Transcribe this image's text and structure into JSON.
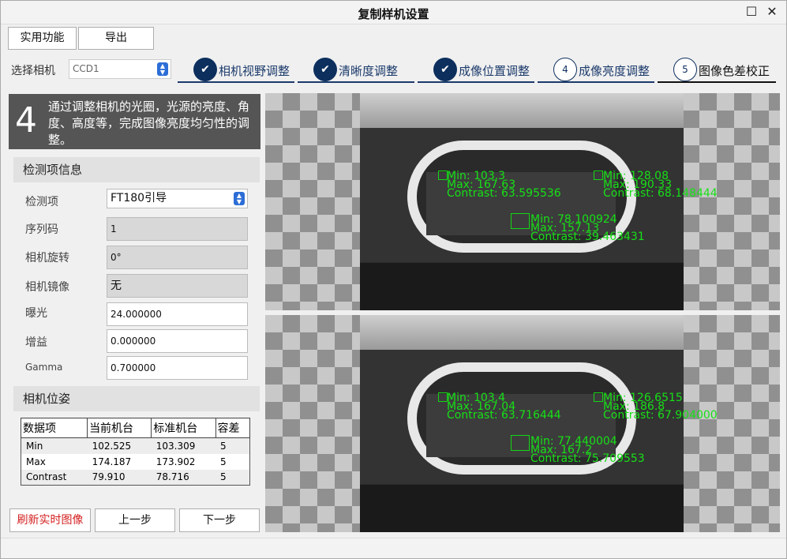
{
  "window": {
    "title": "复制样机设置",
    "maximize_icon": "maximize-icon",
    "close_icon": "close-icon"
  },
  "menu": {
    "utility": "实用功能",
    "export": "导出"
  },
  "camera": {
    "label": "选择相机",
    "selected": "CCD1"
  },
  "steps": [
    {
      "num": "",
      "label": "相机视野调整",
      "state": "done"
    },
    {
      "num": "",
      "label": "清晰度调整",
      "state": "done"
    },
    {
      "num": "",
      "label": "成像位置调整",
      "state": "done"
    },
    {
      "num": "4",
      "label": "成像亮度调整",
      "state": "todo"
    },
    {
      "num": "5",
      "label": "图像色差校正",
      "state": "todo"
    }
  ],
  "banner": {
    "number": "4",
    "text": "通过调整相机的光圈，光源的亮度、角度、高度等，完成图像亮度均匀性的调整。"
  },
  "inspection": {
    "header": "检测项信息",
    "item_label": "检测项",
    "item_value": "FT180引导",
    "serial_label": "序列码",
    "serial_value": "1",
    "rotation_label": "相机旋转",
    "rotation_value": "0°",
    "mirror_label": "相机镜像",
    "mirror_value": "无",
    "exposure_label": "曝光",
    "exposure_value": "24.000000",
    "gain_label": "增益",
    "gain_value": "0.000000",
    "gamma_label": "Gamma",
    "gamma_value": "0.700000"
  },
  "pose": {
    "header": "相机位姿",
    "columns": [
      "数据项",
      "当前机台",
      "标准机台",
      "容差"
    ],
    "rows": [
      [
        "Min",
        "102.525",
        "103.309",
        "5"
      ],
      [
        "Max",
        "174.187",
        "173.902",
        "5"
      ],
      [
        "Contrast",
        "79.910",
        "78.716",
        "5"
      ]
    ]
  },
  "buttons": {
    "refresh": "刷新实时图像",
    "prev": "上一步",
    "next": "下一步"
  },
  "colors": {
    "accent": "#1b3a6b",
    "refresh_text": "#d42020",
    "annotation": "#17e017"
  },
  "image_top": {
    "roi_a": {
      "l1": "Min: 103.3",
      "l2": "Max: 167.63",
      "l3": "Contrast: 63.595536"
    },
    "roi_b": {
      "l1": "Min: 128.08",
      "l2": "Max: 190.33",
      "l3": "Contrast: 68.148444"
    },
    "roi_c": {
      "l1": "Min: 78.100924",
      "l2": "Max: 157.13",
      "l3": "Contrast: 39.463431"
    }
  },
  "image_bottom": {
    "roi_a": {
      "l1": "Min: 103.4",
      "l2": "Max: 167.04",
      "l3": "Contrast: 63.716444"
    },
    "roi_b": {
      "l1": "Min: 126.6515",
      "l2": "Max: 186.8",
      "l3": "Contrast: 67.904000"
    },
    "roi_c": {
      "l1": "Min: 77.440004",
      "l2": "Max: 167.2",
      "l3": "Contrast: 75.709553"
    }
  }
}
